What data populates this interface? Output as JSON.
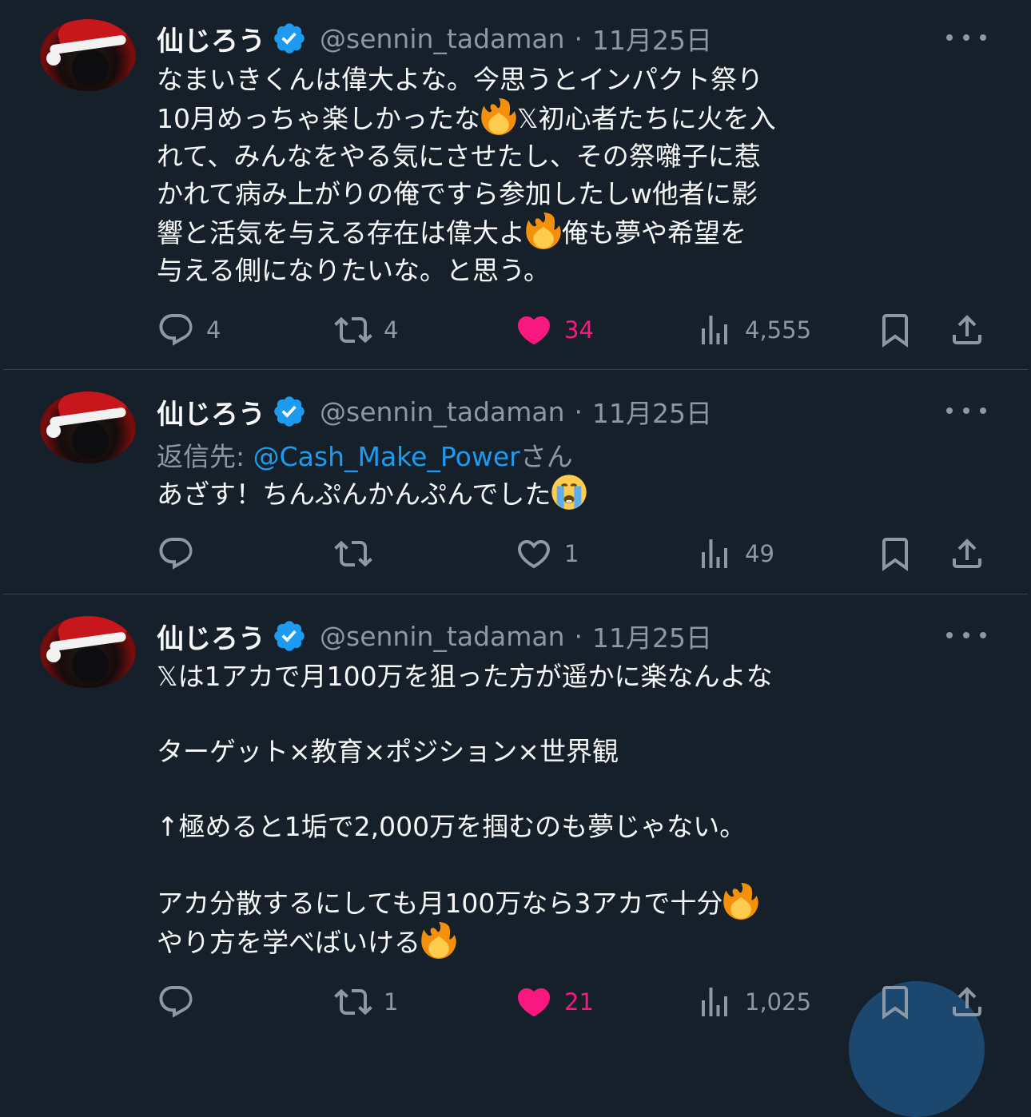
{
  "colors": {
    "background": "#15202b",
    "text": "#f7f9f9",
    "muted": "#8b98a5",
    "accent": "#1d9bf0",
    "like": "#f91880",
    "divider": "#38444d"
  },
  "tweets": [
    {
      "name": "仙じろう",
      "handle": "@sennin_tadaman",
      "separator": "·",
      "date": "11月25日",
      "lines": [
        [
          "なまいきくんは偉大よな。今思うとインパクト祭り"
        ],
        [
          "10月めっちゃ楽しかったな",
          "🔥",
          "𝕏初心者たちに火を入"
        ],
        [
          "れて、みんなをやる気にさせたし、その祭囃子に惹"
        ],
        [
          "かれて病み上がりの俺ですら参加したしw他者に影"
        ],
        [
          "響と活気を与える存在は偉大よ",
          "🔥",
          "俺も夢や希望を"
        ],
        [
          "与える側になりたいな。と思う。"
        ]
      ],
      "stats": {
        "replies": "4",
        "reposts": "4",
        "likes": "34",
        "views": "4,555"
      },
      "liked": true
    },
    {
      "name": "仙じろう",
      "handle": "@sennin_tadaman",
      "separator": "·",
      "date": "11月25日",
      "reply_prefix": "返信先: ",
      "reply_mention": "@Cash_Make_Power",
      "reply_suffix": "さん",
      "text_main": "あざす！ちんぷんかんぷんでした",
      "text_emoji": "😭",
      "stats": {
        "replies": "",
        "reposts": "",
        "likes": "1",
        "views": "49"
      },
      "liked": false
    },
    {
      "name": "仙じろう",
      "handle": "@sennin_tadaman",
      "separator": "·",
      "date": "11月25日",
      "line1": "𝕏は1アカで月100万を狙った方が遥かに楽なんよな",
      "line2": "ターゲット×教育×ポジション×世界観",
      "line3": "↑極めると1垢で2,000万を掴むのも夢じゃない。",
      "line4": "アカ分散するにしても月100万なら3アカで十分",
      "line4_emoji": "🔥",
      "line5": "やり方を学べばいける",
      "line5_emoji": "🔥",
      "stats": {
        "replies": "",
        "reposts": "1",
        "likes": "21",
        "views": "1,025"
      },
      "liked": true
    }
  ],
  "icons": {
    "verified": "verified-badge-icon",
    "more": "more-dots-icon",
    "reply": "reply-bubble-icon",
    "repost": "repost-arrows-icon",
    "like": "heart-icon",
    "views": "views-bar-chart-icon",
    "bookmark": "bookmark-icon",
    "share": "share-upload-icon",
    "fire": "fire-emoji-icon",
    "crying": "crying-face-emoji-icon"
  }
}
